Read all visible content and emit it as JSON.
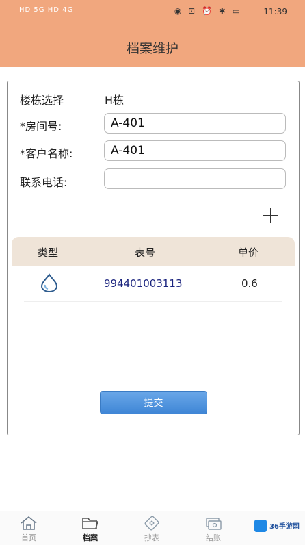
{
  "status_bar": {
    "time": "11:39",
    "left_text": "HD 5G HD 4G"
  },
  "appbar": {
    "title": "档案维护"
  },
  "form": {
    "building_label": "楼栋选择",
    "building_value": "H栋",
    "room_label": "*房间号:",
    "room_value": "A-401",
    "customer_label": "*客户名称:",
    "customer_value": "A-401",
    "phone_label": "联系电话:",
    "phone_value": ""
  },
  "table": {
    "headers": [
      "类型",
      "表号",
      "单价"
    ],
    "rows": [
      {
        "type_icon": "water-drop-icon",
        "meter_no": "994401003113",
        "price": "0.6"
      }
    ]
  },
  "submit_label": "提交",
  "nav": {
    "items": [
      {
        "label": "首页",
        "icon": "home-icon"
      },
      {
        "label": "档案",
        "icon": "folder-icon",
        "active": true
      },
      {
        "label": "抄表",
        "icon": "meter-icon"
      },
      {
        "label": "结账",
        "icon": "money-icon"
      }
    ]
  },
  "watermark": {
    "text": "36手游网"
  },
  "colors": {
    "header_bg": "#f1a77e",
    "table_head_bg": "#efe4d8",
    "submit_blue": "#3f86d6",
    "meter_no_color": "#1a237e"
  }
}
